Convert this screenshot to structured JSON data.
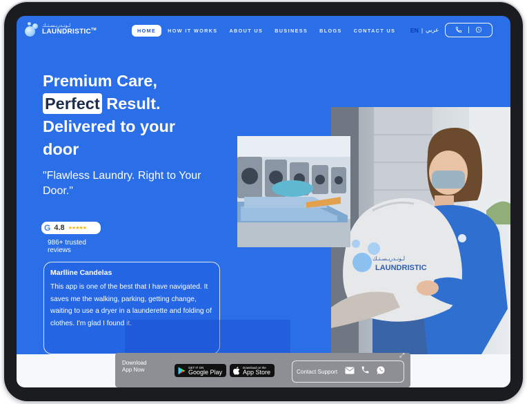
{
  "brand": {
    "name": "LAUNDRISTIC",
    "mark": "TM",
    "arabic_name": "لـونـدريـسـتـك",
    "accent": "#2a6ee8",
    "highlight_text": "#1d2c4a"
  },
  "nav": {
    "items": [
      "HOME",
      "HOW IT WORKS",
      "ABOUT US",
      "BUSINESS",
      "BLOGS",
      "CONTACT US"
    ],
    "active": "HOME"
  },
  "lang": {
    "en": "EN",
    "separator": "|",
    "ar": "عربي"
  },
  "contact_pill": {
    "separator": "|",
    "icons": [
      "phone-icon",
      "whatsapp-icon"
    ]
  },
  "hero": {
    "line1": "Premium Care,",
    "highlight": "Perfect",
    "line2_rest": "Result.",
    "line3": "Delivered to your",
    "line4": "door",
    "subtitle": "\"Flawless Laundry. Right to Your Door.\""
  },
  "rating": {
    "icon": "google-icon",
    "letter": "G",
    "score": "4.8",
    "stars": "★★★★★",
    "stars_value": 5,
    "reviews": "986+ trusted reviews"
  },
  "review": {
    "name": "Marlline Candelas",
    "text": "This app is one of the best that I have navigated. It saves me the walking, parking, getting change, waiting to use a dryer in a launderette and folding of clothes. I'm glad I found it."
  },
  "bag_print": {
    "arabic": "لـونـدريـسـتـك",
    "name": "LAUNDRISTIC"
  },
  "download": {
    "label": "Download App Now",
    "google": {
      "small": "GET IT ON",
      "big": "Google Play"
    },
    "apple": {
      "small": "Download on the",
      "big": "App Store"
    }
  },
  "support": {
    "label": "Contact Support",
    "icons": [
      "mail-icon",
      "phone-icon",
      "whatsapp-icon"
    ]
  }
}
